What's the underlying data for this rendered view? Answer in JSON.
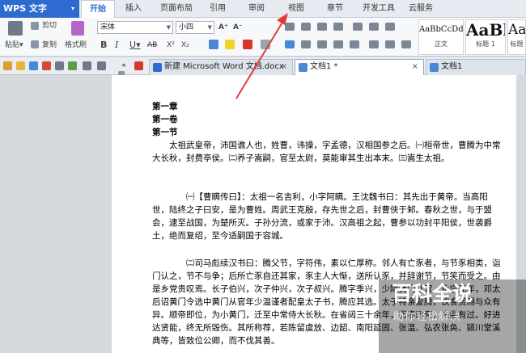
{
  "app": {
    "name": "WPS 文字",
    "menu_arrow": "▾"
  },
  "menu": [
    "开始",
    "插入",
    "页面布局",
    "引用",
    "审阅",
    "视图",
    "章节",
    "开发工具",
    "云服务"
  ],
  "menu_active": "开始",
  "ribbon": {
    "paste": "粘贴",
    "paste_arrow": "▾",
    "cut": "剪切",
    "copy": "复制",
    "format_painter": "格式刷",
    "font_name": "宋体",
    "font_size": "小四",
    "bold": "B",
    "italic": "I",
    "underline": "U",
    "underline_arrow": "▾",
    "strike": "AB",
    "superscript": "X²",
    "subscript": "X₂",
    "grow_font": "A⁺",
    "shrink_font": "A⁻",
    "styles": [
      {
        "sample": "AaBbCcDd",
        "name": "正文"
      },
      {
        "sample": "AaBl",
        "name": "标题 1"
      },
      {
        "sample": "AaE",
        "name": "标题"
      }
    ]
  },
  "tabs": [
    {
      "label": "新建 Microsoft Word 文档.docx",
      "close": "×"
    },
    {
      "label": "文档1 *",
      "close": "×"
    },
    {
      "label": "文档1",
      "close": ""
    }
  ],
  "tab_scroll": "◂",
  "document": {
    "heading1": "第一章",
    "heading2": "第一卷",
    "heading3": "第一节",
    "p1": "太祖武皇帝，沛国谯人也，姓曹，讳操，字孟德，汉相国参之后。㈠桓帝世，曹腾为中常大长秋，封费亭侯。㈡养子嵩嗣，官至太尉，莫能审其生出本末。㈢嵩生太祖。",
    "p2": "㈠【曹瞒传曰】：太祖一名吉利，小字阿瞒。王沈魏书曰：其先出于黄帝。当高阳世，陆终之子曰安，是为曹姓。周武王克殷，存先世之后，封曹侠于邾。春秋之世，与于盟会，逮至战国，为楚所灭。子孙分流，或家于沛。汉高祖之起，曹参以功封平阳侯，世袭爵土，绝而复绍，至今适嗣国于容城。",
    "p3": "㈡司马彪续汉书曰：腾父节，字符伟，素以仁厚称。邻人有亡豕者，与节豕相类，诣门认之，节不与争；后所亡豕自还其家，豕主人大惭，送所认豕，并辞谢节，节笑而受之。由是乡党贵叹焉。长子伯兴，次子仲兴，次子叔兴。腾字季兴，少除黄门从官。永宁元年，邓太后诏黄门令选中黄门从官年少温谨者配皇太子书，腾应其选。太子特亲爱腾，饮食赏赐与众有异。顺帝即位，为小黄门，迁至中常侍大长秋。在省闼三十余年，历事四帝，未尝有过。好进达贤能，终无所毁伤。其所称荐，若陈留虞放、边韶、南阳延固、张温、弘农张奂、颍川堂溪典等，皆致位公卿，而不伐其善。"
  },
  "watermark": {
    "title": "百科全说",
    "subtitle": "助你轻松解决"
  }
}
